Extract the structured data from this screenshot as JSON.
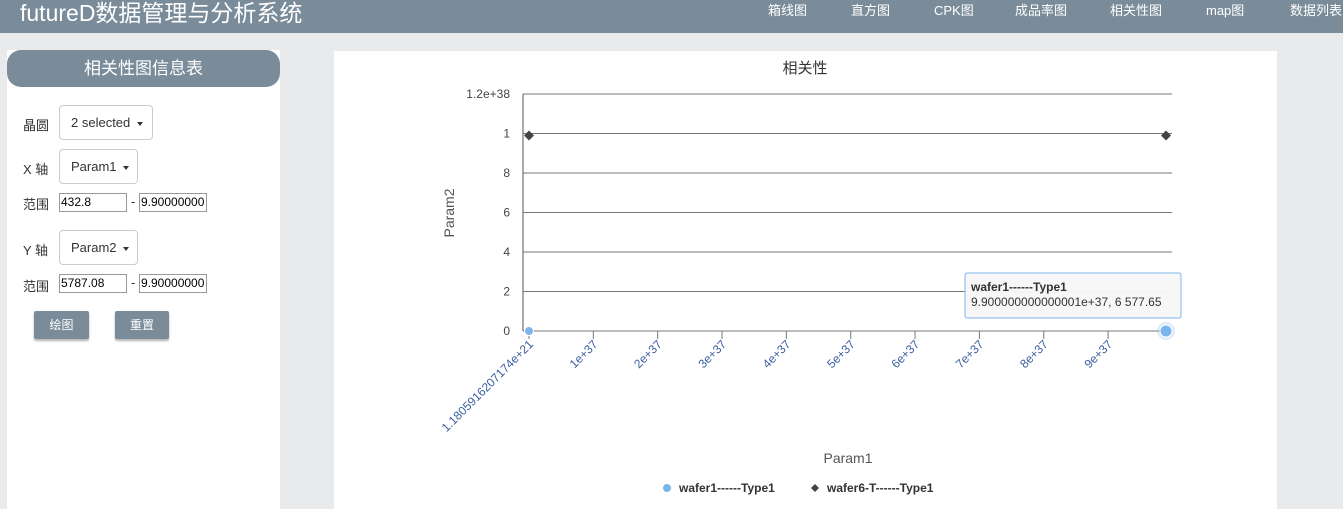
{
  "app": {
    "title": "futureD数据管理与分析系统"
  },
  "nav": [
    {
      "label": "箱线图"
    },
    {
      "label": "直方图"
    },
    {
      "label": "CPK图"
    },
    {
      "label": "成品率图"
    },
    {
      "label": "相关性图"
    },
    {
      "label": "map图"
    },
    {
      "label": "数据列表"
    }
  ],
  "panel": {
    "title": "相关性图信息表",
    "wafer_label": "晶圆",
    "wafer_value": "2 selected",
    "x_label": "X 轴",
    "x_value": "Param1",
    "x_range_label": "范围",
    "x_min": "432.8",
    "x_max": "9.90000000",
    "y_label": "Y 轴",
    "y_value": "Param2",
    "y_range_label": "范围",
    "y_min": "5787.08",
    "y_max": "9.90000000",
    "range_sep": "-",
    "draw_button": "绘图",
    "reset_button": "重置"
  },
  "colors": {
    "topbar": "#7a8c9a",
    "series1": "#7cb5ec",
    "series2": "#434348"
  },
  "chart_data": {
    "type": "scatter",
    "title": "相关性",
    "xlabel": "Param1",
    "ylabel": "Param2",
    "x_ticks": [
      "1.1805916207174e+21",
      "1e+37",
      "2e+37",
      "3e+37",
      "4e+37",
      "5e+37",
      "6e+37",
      "7e+37",
      "8e+37",
      "9e+37"
    ],
    "x_tick_values": [
      1.1805916207174e+21,
      1e+37,
      2e+37,
      3e+37,
      4e+37,
      5e+37,
      6e+37,
      7e+37,
      8e+37,
      9e+37
    ],
    "xlim": [
      1.1805916207174e+21,
      9.9e+37
    ],
    "y_ticks": [
      "0",
      "2",
      "4",
      "6",
      "8",
      "1",
      "1.2e+38"
    ],
    "y_tick_values": [
      0,
      2e+37,
      4e+37,
      6e+37,
      8e+37,
      1e+38,
      1.2e+38
    ],
    "ylim": [
      0,
      1.2e+38
    ],
    "legend_position": "bottom",
    "grid": true,
    "series": [
      {
        "name": "wafer1------Type1",
        "marker": "circle",
        "color": "#7cb5ec",
        "points": [
          [
            1.1805916207174e+21,
            0
          ],
          [
            9.9e+37,
            6577.65
          ]
        ]
      },
      {
        "name": "wafer6-T------Type1",
        "marker": "diamond",
        "color": "#434348",
        "points": [
          [
            1.1805916207174e+21,
            9.9e+37
          ],
          [
            9.9e+37,
            9.9e+37
          ]
        ]
      }
    ],
    "tooltip": {
      "title": "wafer1------Type1",
      "text": "9.900000000000001e+37, 6 577.65"
    }
  }
}
